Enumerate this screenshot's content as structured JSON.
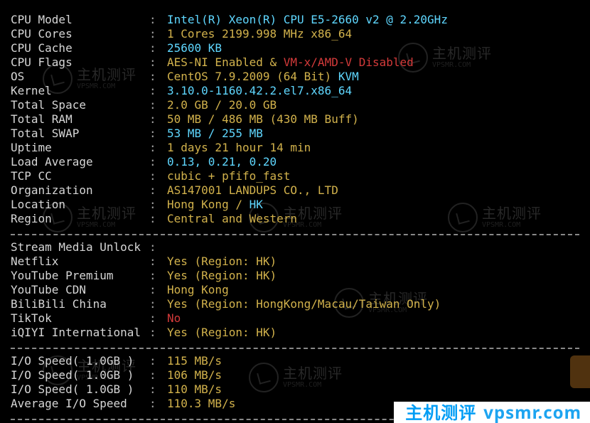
{
  "watermark": {
    "title": "主机测评",
    "sub": "VPSMR.COM"
  },
  "badge": {
    "title": "主机测评",
    "domain": "vpsmr.com"
  },
  "section_info": [
    {
      "label": "CPU Model",
      "parts": [
        {
          "text": "Intel(R) Xeon(R) CPU E5-2660 v2 @ 2.20GHz",
          "cls": "cyan"
        }
      ]
    },
    {
      "label": "CPU Cores",
      "parts": [
        {
          "text": "1 Cores 2199.998 MHz x86_64",
          "cls": "yel"
        }
      ]
    },
    {
      "label": "CPU Cache",
      "parts": [
        {
          "text": "25600 KB",
          "cls": "cyan"
        }
      ]
    },
    {
      "label": "CPU Flags",
      "parts": [
        {
          "text": "AES-NI Enabled & ",
          "cls": "yel"
        },
        {
          "text": "VM-x/AMD-V Disabled",
          "cls": "red"
        }
      ]
    },
    {
      "label": "OS",
      "parts": [
        {
          "text": "CentOS 7.9.2009 (64 Bit) ",
          "cls": "yel"
        },
        {
          "text": "KVM",
          "cls": "cyan"
        }
      ]
    },
    {
      "label": "Kernel",
      "parts": [
        {
          "text": "3.10.0-1160.42.2.el7.x86_64",
          "cls": "cyan"
        }
      ]
    },
    {
      "label": "Total Space",
      "parts": [
        {
          "text": "2.0 GB / 20.0 GB",
          "cls": "yel"
        }
      ]
    },
    {
      "label": "Total RAM",
      "parts": [
        {
          "text": "50 MB / 486 MB (430 MB Buff)",
          "cls": "yel"
        }
      ]
    },
    {
      "label": "Total SWAP",
      "parts": [
        {
          "text": "53 MB / 255 MB",
          "cls": "cyan"
        }
      ]
    },
    {
      "label": "Uptime",
      "parts": [
        {
          "text": "1 days 21 hour 14 min",
          "cls": "yel"
        }
      ]
    },
    {
      "label": "Load Average",
      "parts": [
        {
          "text": "0.13, 0.21, 0.20",
          "cls": "cyan"
        }
      ]
    },
    {
      "label": "TCP CC",
      "parts": [
        {
          "text": "cubic + pfifo_fast",
          "cls": "yel"
        }
      ]
    },
    {
      "label": "Organization",
      "parts": [
        {
          "text": "AS147001 LANDUPS CO., LTD",
          "cls": "yel"
        }
      ]
    },
    {
      "label": "Location",
      "parts": [
        {
          "text": "Hong Kong / ",
          "cls": "yel"
        },
        {
          "text": "HK",
          "cls": "cyan"
        }
      ]
    },
    {
      "label": "Region",
      "parts": [
        {
          "text": "Central and Western",
          "cls": "yel"
        }
      ]
    }
  ],
  "section_stream_header": {
    "label": "Stream Media Unlock",
    "parts": []
  },
  "section_stream": [
    {
      "label": "Netflix",
      "parts": [
        {
          "text": "Yes (Region: HK)",
          "cls": "yel"
        }
      ]
    },
    {
      "label": "YouTube Premium",
      "parts": [
        {
          "text": "Yes (Region: HK)",
          "cls": "yel"
        }
      ]
    },
    {
      "label": "YouTube CDN",
      "parts": [
        {
          "text": "Hong Kong",
          "cls": "yel"
        }
      ]
    },
    {
      "label": "BiliBili China",
      "parts": [
        {
          "text": "Yes (Region: HongKong/Macau/Taiwan Only)",
          "cls": "yel"
        }
      ]
    },
    {
      "label": "TikTok",
      "parts": [
        {
          "text": "No",
          "cls": "red"
        }
      ]
    },
    {
      "label": "iQIYI International",
      "parts": [
        {
          "text": "Yes (Region: HK)",
          "cls": "yel"
        }
      ]
    }
  ],
  "section_io": [
    {
      "label": "I/O Speed( 1.0GB )",
      "parts": [
        {
          "text": "115 MB/s",
          "cls": "yel"
        }
      ]
    },
    {
      "label": "I/O Speed( 1.0GB )",
      "parts": [
        {
          "text": "106 MB/s",
          "cls": "yel"
        }
      ]
    },
    {
      "label": "I/O Speed( 1.0GB )",
      "parts": [
        {
          "text": "110 MB/s",
          "cls": "yel"
        }
      ]
    },
    {
      "label": "Average I/O Speed",
      "parts": [
        {
          "text": "110.3 MB/s",
          "cls": "yel"
        }
      ]
    }
  ]
}
